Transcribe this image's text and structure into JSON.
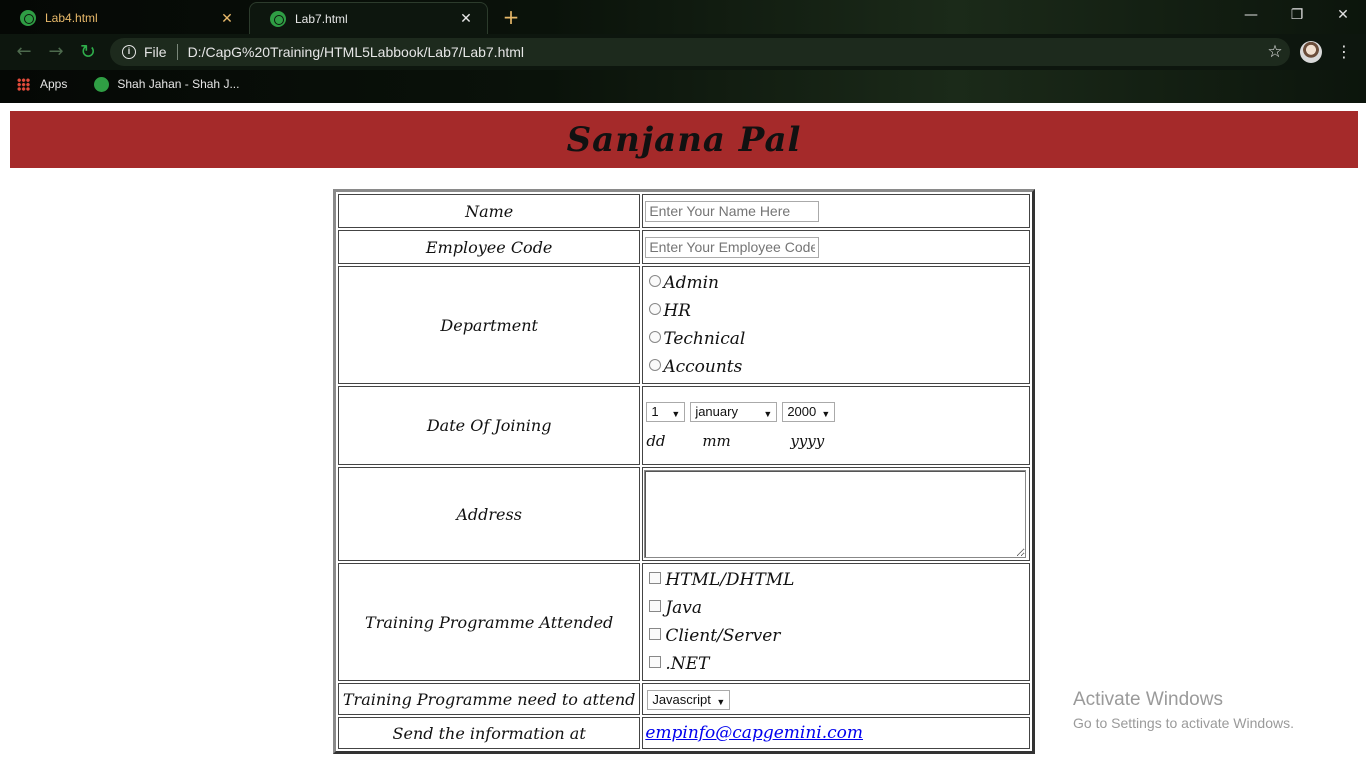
{
  "browser": {
    "tabs": [
      {
        "title": "Lab4.html",
        "active": false
      },
      {
        "title": "Lab7.html",
        "active": true
      }
    ],
    "new_tab": "+",
    "window_controls": {
      "minimize": "—",
      "maximize": "❐",
      "close": "✕"
    },
    "address": {
      "scheme_label": "File",
      "url": "D:/CapG%20Training/HTML5Labbook/Lab7/Lab7.html"
    },
    "bookmarks": [
      {
        "label": "Apps",
        "icon": "apps-grid-icon"
      },
      {
        "label": "Shah Jahan - Shah J...",
        "icon": "globe-icon"
      }
    ]
  },
  "page": {
    "header": {
      "title": "Sanjana Pal",
      "background": "#a52a2a"
    },
    "form": {
      "name": {
        "label": "Name",
        "placeholder": "Enter Your Name Here"
      },
      "employee_code": {
        "label": "Employee Code",
        "placeholder": "Enter Your Employee Code"
      },
      "department": {
        "label": "Department",
        "options": [
          "Admin",
          "HR",
          "Technical",
          "Accounts"
        ]
      },
      "date_of_joining": {
        "label": "Date Of Joining",
        "day": "1",
        "month": "january",
        "year": "2000",
        "hints": [
          "dd",
          "mm",
          "yyyy"
        ]
      },
      "address": {
        "label": "Address"
      },
      "training_attended": {
        "label": "Training Programme Attended",
        "options": [
          "HTML/DHTML",
          "Java",
          "Client/Server",
          ".NET"
        ]
      },
      "training_needed": {
        "label": "Training Programme need to attend",
        "selected": "Javascript"
      },
      "send_info": {
        "label": "Send the information at",
        "email": "empinfo@capgemini.com"
      }
    }
  },
  "watermark": {
    "title": "Activate Windows",
    "subtitle": "Go to Settings to activate Windows."
  }
}
